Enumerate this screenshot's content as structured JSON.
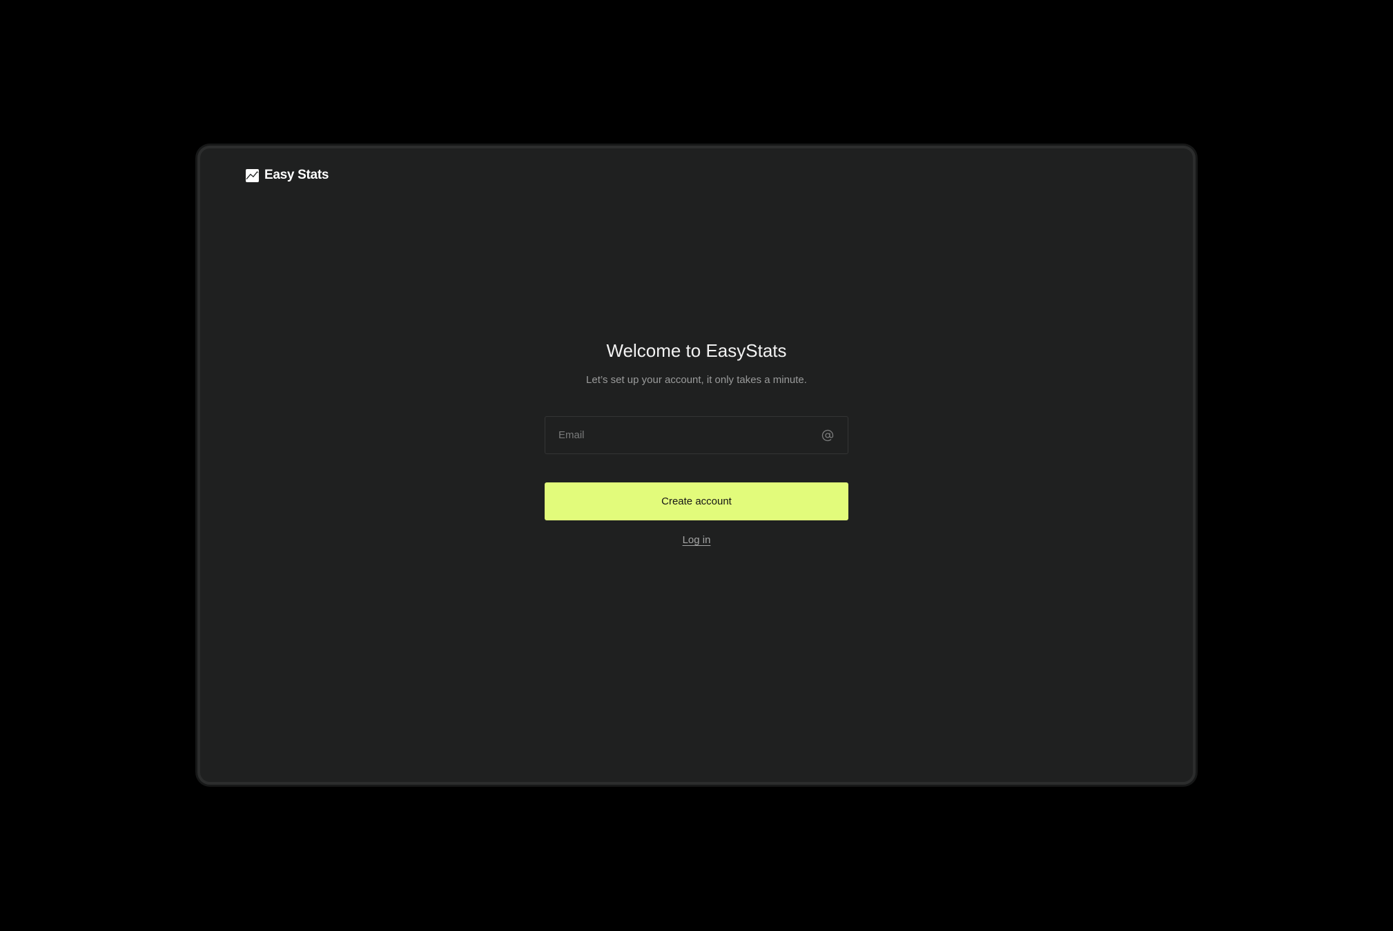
{
  "brand": {
    "name": "Easy Stats",
    "icon": "chart-trend-logo-icon"
  },
  "welcome": {
    "title": "Welcome to EasyStats",
    "subtitle": "Let’s set up your account, it only takes a minute."
  },
  "form": {
    "email": {
      "placeholder": "Email",
      "value": "",
      "icon": "at-sign-icon"
    },
    "create_account_label": "Create account",
    "login_label": "Log in"
  },
  "colors": {
    "accent": "#e2fb7b",
    "panel_background": "#1f2020",
    "page_background": "#000000"
  }
}
